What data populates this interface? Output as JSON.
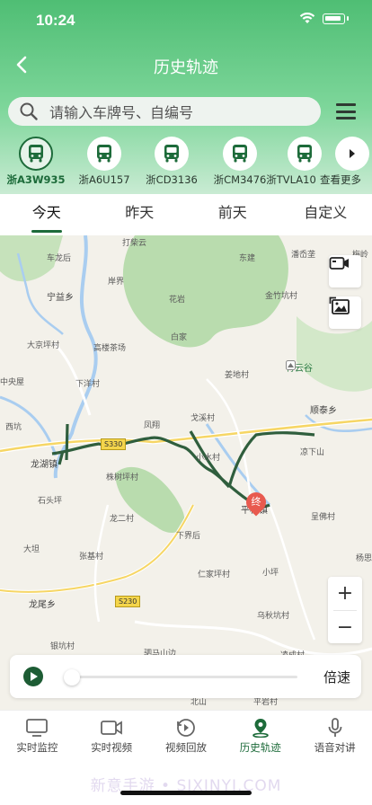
{
  "status_bar": {
    "time": "10:24"
  },
  "header": {
    "title": "历史轨迹",
    "back_icon": "chevron-left-icon"
  },
  "search": {
    "placeholder": "请输入车牌号、自编号",
    "menu_icon": "menu-icon"
  },
  "vehicles": [
    {
      "plate": "浙A3W935",
      "active": true
    },
    {
      "plate": "浙A6U157",
      "active": false
    },
    {
      "plate": "浙CD3136",
      "active": false
    },
    {
      "plate": "浙CM3476",
      "active": false
    },
    {
      "plate": "浙TVLA10",
      "active": false
    }
  ],
  "vehicles_more_label": "查看更多",
  "date_tabs": [
    {
      "label": "今天",
      "active": true
    },
    {
      "label": "昨天",
      "active": false
    },
    {
      "label": "前天",
      "active": false
    },
    {
      "label": "自定义",
      "active": false
    }
  ],
  "map": {
    "labels": [
      "打柴云",
      "东建",
      "潘岙垄",
      "梅岭",
      "车龙后",
      "岸界",
      "宁益乡",
      "花岩",
      "金竹坑村",
      "白家",
      "大京坪村",
      "高楼茶场",
      "姜地村",
      "中央屋",
      "下洋村",
      "顺泰乡",
      "西坑",
      "凤翔",
      "戈溪村",
      "龙湖镇",
      "小水村",
      "凉下山",
      "株树坪村",
      "石头坪",
      "龙二村",
      "平桥镇",
      "呈佛村",
      "下界后",
      "大坦",
      "张基村",
      "杨思田",
      "仁家坪村",
      "小坪",
      "龙尾乡",
      "乌秋坑村",
      "银坑村",
      "驷马山边",
      "凌成村",
      "北山",
      "平岩村"
    ],
    "poi": "青云谷",
    "roads": [
      "S330",
      "S230"
    ],
    "end_marker": "终",
    "zoom_in": "+",
    "zoom_out": "−",
    "route_color": "#2f5e3d"
  },
  "playback": {
    "speed_label": "倍速",
    "progress": 0
  },
  "bottom_nav": [
    {
      "label": "实时监控",
      "icon": "monitor-icon",
      "active": false
    },
    {
      "label": "实时视频",
      "icon": "video-camera-icon",
      "active": false
    },
    {
      "label": "视频回放",
      "icon": "replay-icon",
      "active": false
    },
    {
      "label": "历史轨迹",
      "icon": "location-pin-icon",
      "active": true
    },
    {
      "label": "语音对讲",
      "icon": "microphone-icon",
      "active": false
    }
  ],
  "watermark": "新意手游 • SIXINYI.COM",
  "colors": {
    "accent": "#1d6b3a",
    "header_top": "#4fbe74",
    "end_marker": "#e85a4f"
  }
}
